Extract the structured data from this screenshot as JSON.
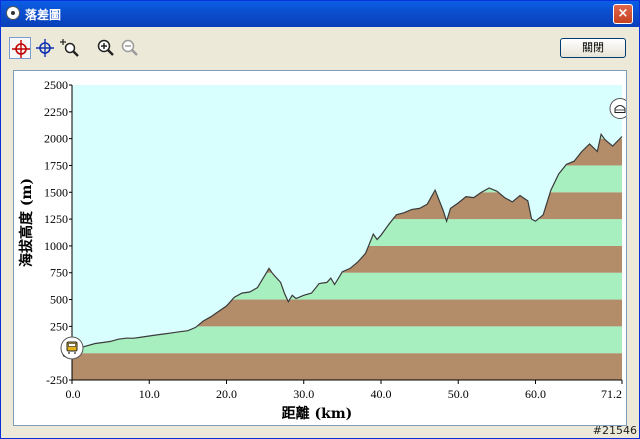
{
  "window": {
    "title": "落差圖",
    "close_glyph": "×"
  },
  "toolbar": {
    "tools": [
      {
        "name": "crosshair-red-icon",
        "active": true
      },
      {
        "name": "crosshair-blue-icon",
        "active": false
      },
      {
        "name": "zoom-area-icon",
        "active": false
      },
      {
        "name": "zoom-in-icon",
        "active": false
      },
      {
        "name": "zoom-out-icon",
        "active": false
      }
    ],
    "close_label": "關閉"
  },
  "watermark": "#21546",
  "colors": {
    "sky": "#D9FEFE",
    "band_brown": "#B38C6A",
    "band_green": "#A8EFC0",
    "outline": "#3A3A3A"
  },
  "chart_data": {
    "type": "area",
    "title": "",
    "xlabel": "距離 (km)",
    "ylabel": "海拔高度 (m)",
    "xlim": [
      0,
      71.2
    ],
    "ylim": [
      -250,
      2500
    ],
    "x_ticks": [
      "0.0",
      "10.0",
      "20.0",
      "30.0",
      "40.0",
      "50.0",
      "60.0",
      "71.2"
    ],
    "x_tick_values": [
      0,
      10,
      20,
      30,
      40,
      50,
      60,
      71.2
    ],
    "y_ticks": [
      "2500",
      "2250",
      "2000",
      "1750",
      "1500",
      "1250",
      "1000",
      "750",
      "500",
      "250",
      "0",
      "-250"
    ],
    "y_tick_values": [
      2500,
      2250,
      2000,
      1750,
      1500,
      1250,
      1000,
      750,
      500,
      250,
      0,
      -250
    ],
    "bands": [
      -250,
      0,
      250,
      500,
      750,
      1000,
      1250,
      1500,
      1750,
      2000,
      2250
    ],
    "start_marker": "bus-icon",
    "end_marker": "shelter-icon",
    "series": [
      {
        "x": [
          0,
          1,
          2,
          3,
          4,
          5,
          6,
          7,
          8,
          9,
          10,
          11,
          12,
          13,
          14,
          15,
          16,
          17,
          18,
          19,
          20,
          21,
          22,
          23,
          24,
          25,
          25.5,
          26,
          27,
          27.5,
          28,
          28.5,
          29,
          30,
          31,
          32,
          33,
          33.5,
          34,
          35,
          36,
          37,
          38,
          38.5,
          39,
          39.5,
          40,
          41,
          42,
          43,
          44,
          45,
          46,
          47,
          48,
          48.5,
          49,
          50,
          51,
          52,
          53,
          54,
          55,
          56,
          57,
          58,
          59,
          59.5,
          60,
          61,
          62,
          63,
          64,
          65,
          66,
          67,
          68,
          68.5,
          69,
          70,
          71.2
        ],
        "y": [
          30,
          50,
          70,
          90,
          100,
          110,
          130,
          140,
          140,
          150,
          160,
          170,
          180,
          190,
          200,
          210,
          240,
          300,
          340,
          390,
          440,
          520,
          560,
          570,
          610,
          730,
          790,
          740,
          660,
          560,
          480,
          540,
          510,
          540,
          560,
          650,
          660,
          700,
          640,
          760,
          790,
          850,
          930,
          1020,
          1110,
          1060,
          1100,
          1200,
          1290,
          1310,
          1340,
          1350,
          1390,
          1520,
          1340,
          1230,
          1350,
          1400,
          1460,
          1450,
          1500,
          1540,
          1510,
          1450,
          1410,
          1470,
          1420,
          1250,
          1230,
          1290,
          1520,
          1670,
          1760,
          1790,
          1880,
          1950,
          1880,
          2040,
          1990,
          1930,
          2020
        ]
      }
    ]
  }
}
